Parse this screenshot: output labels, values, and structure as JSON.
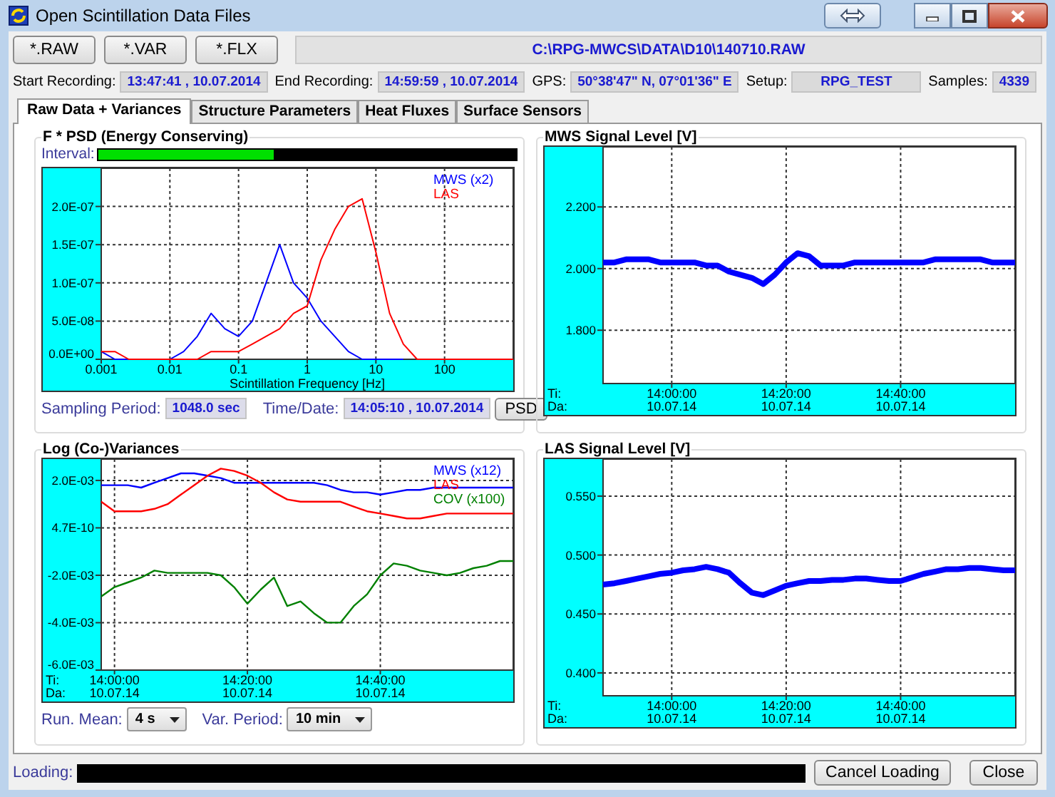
{
  "window": {
    "title": "Open Scintillation Data Files"
  },
  "toolbar": {
    "buttons": [
      "*.RAW",
      "*.VAR",
      "*.FLX"
    ],
    "file_path": "C:\\RPG-MWCS\\DATA\\D10\\140710.RAW"
  },
  "info": [
    {
      "label": "Start Recording:",
      "value": "13:47:41 , 10.07.2014"
    },
    {
      "label": "End Recording:",
      "value": "14:59:59 , 10.07.2014"
    },
    {
      "label": "GPS:",
      "value": "50°38'47\" N, 07°01'36\" E"
    },
    {
      "label": "Setup:",
      "value": "RPG_TEST"
    },
    {
      "label": "Samples:",
      "value": "4339"
    }
  ],
  "tabs": [
    {
      "label": "Raw Data + Variances",
      "selected": true
    },
    {
      "label": "Structure Parameters",
      "selected": false
    },
    {
      "label": "Heat Fluxes",
      "selected": false
    },
    {
      "label": "Surface Sensors",
      "selected": false
    }
  ],
  "psd_panel": {
    "title": "F * PSD (Energy Conserving)",
    "interval": {
      "label": "Interval:",
      "level": 0.42
    },
    "chart_data": {
      "type": "line",
      "xlabel": "Scintillation Frequency [Hz]",
      "categories": [
        "0.001",
        null,
        null,
        null,
        null,
        "0.01",
        null,
        null,
        null,
        null,
        "0.1",
        null,
        null,
        null,
        null,
        "1",
        null,
        null,
        null,
        null,
        "10",
        null,
        null,
        null,
        null,
        "100",
        null,
        null,
        null,
        null,
        null
      ],
      "series": [
        {
          "name": "MWS (x2)",
          "color": "#0000ff",
          "values": [
            1e-08,
            0,
            0,
            0,
            0,
            0,
            1e-08,
            3e-08,
            6e-08,
            4e-08,
            3e-08,
            5e-08,
            1e-07,
            1.5e-07,
            1e-07,
            8e-08,
            5e-08,
            3e-08,
            1e-08,
            0,
            0,
            0,
            0,
            null,
            null,
            null,
            null,
            null,
            null,
            null,
            null
          ]
        },
        {
          "name": "LAS",
          "color": "#ff0000",
          "values": [
            1e-08,
            1e-08,
            0,
            0,
            0,
            0,
            0,
            0,
            1e-08,
            1e-08,
            1e-08,
            2e-08,
            3e-08,
            4e-08,
            6e-08,
            7e-08,
            1.3e-07,
            1.7e-07,
            2e-07,
            2.1e-07,
            1.4e-07,
            6e-08,
            2e-08,
            0,
            0,
            0,
            0,
            0,
            0,
            0,
            0
          ]
        }
      ],
      "ylim": [
        0,
        2.5e-07
      ],
      "grid": true,
      "yticks": [
        {
          "value": 0,
          "label": "0.0E+00"
        },
        {
          "value": 5e-08,
          "label": "5.0E-08"
        },
        {
          "value": 1e-07,
          "label": "1.0E-07"
        },
        {
          "value": 1.5e-07,
          "label": "1.5E-07"
        },
        {
          "value": 2e-07,
          "label": "2.0E-07"
        }
      ]
    },
    "sampling_period": {
      "label": "Sampling Period:",
      "value": "1048.0 sec"
    },
    "time_date": {
      "label": "Time/Date:",
      "value": "14:05:10 , 10.07.2014"
    },
    "button": "PSD"
  },
  "variances_panel": {
    "title": "Log (Co-)Variances",
    "chart_data": {
      "type": "line",
      "categories": [
        null,
        "14:00:00",
        null,
        null,
        null,
        null,
        null,
        null,
        null,
        null,
        null,
        "14:20:00",
        null,
        null,
        null,
        null,
        null,
        null,
        null,
        null,
        null,
        "14:40:00",
        null,
        null,
        null,
        null,
        null,
        null,
        null,
        null,
        null,
        null
      ],
      "series": [
        {
          "name": "MWS (x12)",
          "color": "#0000ff",
          "values": [
            0.0018,
            0.0018,
            0.0018,
            0.0017,
            0.0019,
            0.0021,
            0.0023,
            0.0023,
            0.0022,
            0.0021,
            0.0019,
            0.0019,
            0.0019,
            0.0019,
            0.0019,
            0.0019,
            0.0019,
            0.0018,
            0.0016,
            0.0015,
            0.0015,
            0.0014,
            0.0015,
            0.0016,
            0.0016,
            0.0017,
            0.0017,
            0.0017,
            0.0017,
            0.0017,
            0.0017,
            0.0017
          ]
        },
        {
          "name": "LAS",
          "color": "#ff0000",
          "values": [
            0.0011,
            0.0007,
            0.0007,
            0.0007,
            0.0008,
            0.001,
            0.0014,
            0.0018,
            0.0022,
            0.0025,
            0.0024,
            0.0022,
            0.0019,
            0.0015,
            0.0012,
            0.0011,
            0.0011,
            0.0011,
            0.0011,
            0.0009,
            0.0007,
            0.0006,
            0.0005,
            0.0004,
            0.0004,
            0.0005,
            0.0006,
            0.0006,
            0.0006,
            0.0006,
            0.0006,
            0.0006
          ]
        },
        {
          "name": "COV (x100)",
          "color": "#008000",
          "values": [
            -0.0029,
            -0.0025,
            -0.0023,
            -0.0021,
            -0.0018,
            -0.0019,
            -0.0019,
            -0.0019,
            -0.0019,
            -0.002,
            -0.0025,
            -0.0032,
            -0.0026,
            -0.0021,
            -0.0033,
            -0.0031,
            -0.0036,
            -0.004,
            -0.004,
            -0.0033,
            -0.0028,
            -0.002,
            -0.0015,
            -0.0016,
            -0.0018,
            -0.0019,
            -0.002,
            -0.0019,
            -0.0017,
            -0.0016,
            -0.0014,
            -0.0014
          ]
        }
      ],
      "ylim": [
        -0.006,
        0.0029
      ],
      "grid": true,
      "yticks": [
        {
          "value": 0.002,
          "label": "2.0E-03"
        },
        {
          "value": 4.7e-10,
          "label": "4.7E-10"
        },
        {
          "value": -0.002,
          "label": "-2.0E-03"
        },
        {
          "value": -0.004,
          "label": "-4.0E-03"
        },
        {
          "value": -0.006,
          "label": "-6.0E-03"
        }
      ]
    },
    "time_axis": {
      "row_labels": [
        "Ti:",
        "Da:"
      ],
      "dates": [
        "10.07.14",
        "10.07.14",
        "10.07.14"
      ]
    },
    "controls": [
      {
        "label": "Run. Mean:",
        "value": "4 s"
      },
      {
        "label": "Var. Period:",
        "value": "10 min"
      }
    ]
  },
  "signal_panels": [
    {
      "title": "MWS Signal Level [V]",
      "chart_data": {
        "type": "line",
        "categories": [
          null,
          null,
          null,
          null,
          null,
          null,
          "14:00:00",
          null,
          null,
          null,
          null,
          null,
          null,
          null,
          null,
          null,
          "14:20:00",
          null,
          null,
          null,
          null,
          null,
          null,
          null,
          null,
          null,
          "14:40:00",
          null,
          null,
          null,
          null,
          null,
          null,
          null,
          null,
          null,
          null
        ],
        "series": [
          {
            "color": "#0000ff",
            "values": [
              2.02,
              2.02,
              2.03,
              2.03,
              2.03,
              2.02,
              2.02,
              2.02,
              2.02,
              2.01,
              2.01,
              1.99,
              1.98,
              1.97,
              1.95,
              1.98,
              2.02,
              2.05,
              2.04,
              2.01,
              2.01,
              2.01,
              2.02,
              2.02,
              2.02,
              2.02,
              2.02,
              2.02,
              2.02,
              2.03,
              2.03,
              2.03,
              2.03,
              2.03,
              2.02,
              2.02,
              2.02
            ]
          }
        ],
        "ylim": [
          1.627,
          2.395
        ],
        "grid": true,
        "yticks": [
          {
            "value": 1.8,
            "label": "1.800"
          },
          {
            "value": 2,
            "label": "2.000"
          },
          {
            "value": 2.2,
            "label": "2.200"
          }
        ]
      },
      "time_axis": {
        "row_labels": [
          "Ti:",
          "Da:"
        ],
        "dates": [
          "10.07.14",
          "10.07.14",
          "10.07.14"
        ]
      }
    },
    {
      "title": "LAS Signal Level [V]",
      "chart_data": {
        "type": "line",
        "categories": [
          null,
          null,
          null,
          null,
          null,
          null,
          "14:00:00",
          null,
          null,
          null,
          null,
          null,
          null,
          null,
          null,
          null,
          "14:20:00",
          null,
          null,
          null,
          null,
          null,
          null,
          null,
          null,
          null,
          "14:40:00",
          null,
          null,
          null,
          null,
          null,
          null,
          null,
          null,
          null,
          null
        ],
        "series": [
          {
            "color": "#0000ff",
            "values": [
              0.475,
              0.476,
              0.478,
              0.48,
              0.482,
              0.484,
              0.485,
              0.487,
              0.488,
              0.49,
              0.488,
              0.485,
              0.476,
              0.468,
              0.466,
              0.47,
              0.474,
              0.476,
              0.478,
              0.478,
              0.479,
              0.479,
              0.48,
              0.48,
              0.479,
              0.478,
              0.478,
              0.481,
              0.484,
              0.486,
              0.488,
              0.488,
              0.489,
              0.489,
              0.488,
              0.487,
              0.487
            ]
          }
        ],
        "ylim": [
          0.3806,
          0.5814
        ],
        "grid": true,
        "yticks": [
          {
            "value": 0.4,
            "label": "0.400"
          },
          {
            "value": 0.45,
            "label": "0.450"
          },
          {
            "value": 0.5,
            "label": "0.500"
          },
          {
            "value": 0.55,
            "label": "0.550"
          }
        ]
      },
      "time_axis": {
        "row_labels": [
          "Ti:",
          "Da:"
        ],
        "dates": [
          "10.07.14",
          "10.07.14",
          "10.07.14"
        ]
      }
    }
  ],
  "status": {
    "label": "Loading:",
    "level": 0,
    "buttons": [
      "Cancel Loading",
      "Close"
    ]
  }
}
